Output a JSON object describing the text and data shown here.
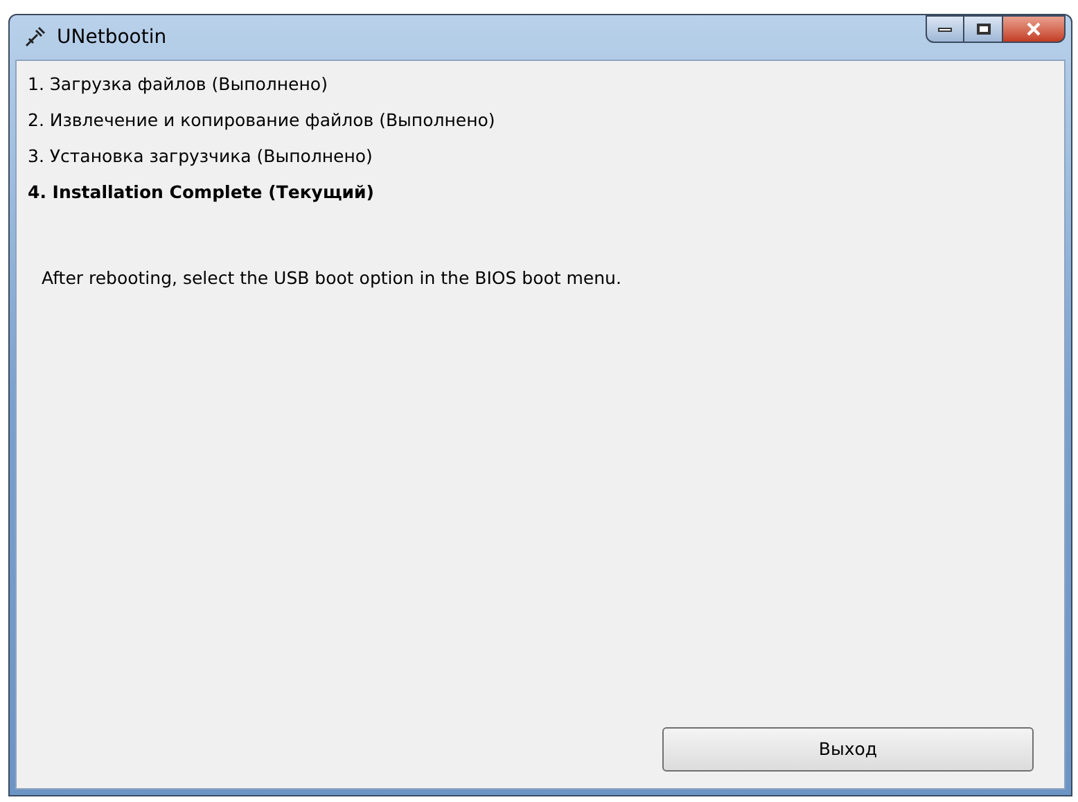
{
  "window": {
    "title": "UNetbootin"
  },
  "steps": [
    {
      "label": "1. Загрузка файлов (Выполнено)",
      "current": false
    },
    {
      "label": "2. Извлечение и копирование файлов (Выполнено)",
      "current": false
    },
    {
      "label": "3. Установка загрузчика (Выполнено)",
      "current": false
    },
    {
      "label": "4. Installation Complete (Текущий)",
      "current": true
    }
  ],
  "message": "After rebooting, select the USB boot option in the BIOS boot menu.",
  "buttons": [
    "Выход"
  ]
}
